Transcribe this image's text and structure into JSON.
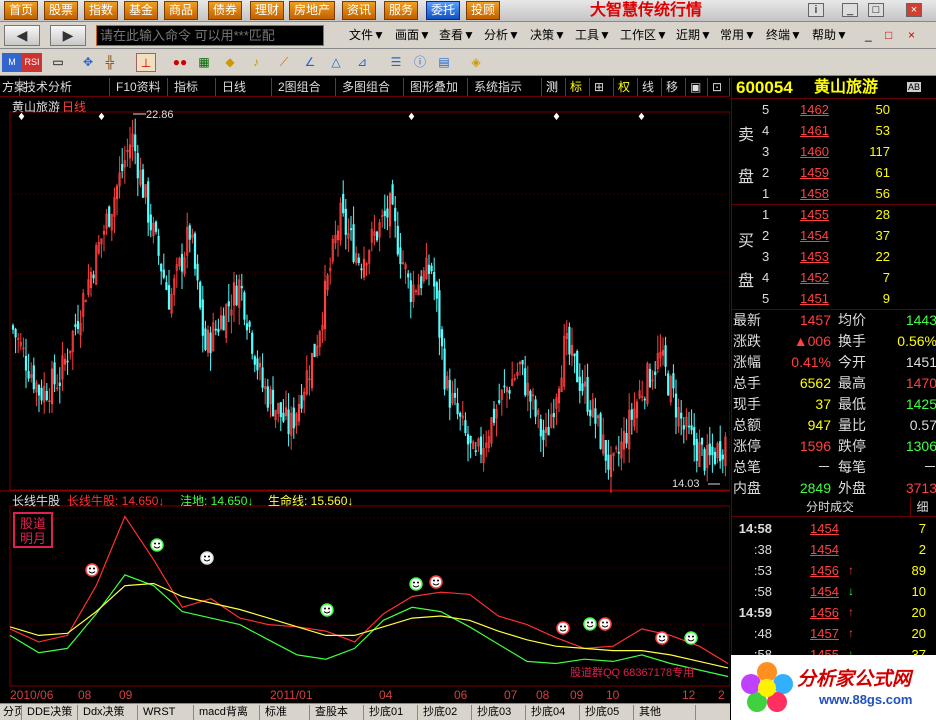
{
  "menu": {
    "buttons": [
      "首页",
      "股票",
      "指数",
      "基金",
      "商品",
      "债券",
      "理财",
      "房地产",
      "资讯",
      "服务",
      "委托",
      "投顾"
    ],
    "app_title": "大智慧传统行情",
    "win_controls": [
      "i",
      "_",
      "□",
      "×"
    ]
  },
  "toolbar": {
    "back": "◀",
    "forward": "▶",
    "command_placeholder": "请在此输入命令   可以用***匹配",
    "items": [
      "文件▼",
      "画面▼",
      "查看▼",
      "分析▼",
      "决策▼",
      "工具▼",
      "工作区▼",
      "近期▼",
      "常用▼",
      "终端▼",
      "帮助▼"
    ],
    "win_controls": [
      "_",
      "□",
      "×"
    ]
  },
  "tabs": [
    "方案",
    "技术分析",
    "F10资料",
    "指标",
    "日线",
    "2图组合",
    "多图组合",
    "图形叠加",
    "系统指示",
    "测",
    "标",
    "⊞",
    "权",
    "线",
    "移",
    "▣",
    "⊡"
  ],
  "chart": {
    "main_label_name": "黄山旅游",
    "main_label_period": "日线",
    "high_marker": "22.86",
    "low_marker": "14.03",
    "indicator_name": "长线牛股",
    "indicator_values": [
      {
        "label": "长线牛股: 14.650↓",
        "color": "#ff3030"
      },
      {
        "label": "洼地: 14.650↓",
        "color": "#40ff40"
      },
      {
        "label": "生命线: 15.560↓",
        "color": "#ffff40"
      }
    ],
    "stamp_line1": "股道",
    "stamp_line2": "明月",
    "watermark": "股道群QQ 68367178专用"
  },
  "chart_data": {
    "type": "line",
    "title": "黄山旅游 日线",
    "series": [
      {
        "name": "长线牛股",
        "color": "#ff3030",
        "values": [
          15.8,
          15.2,
          15.5,
          17.8,
          21.0,
          19.0,
          16.8,
          17.2,
          16.3,
          16.0,
          15.9,
          15.7,
          15.2,
          16.5,
          17.3,
          17.5,
          17.4,
          16.4,
          16.0,
          15.4,
          14.9,
          15.0,
          15.8,
          15.5,
          15.0,
          14.2
        ]
      },
      {
        "name": "洼地",
        "color": "#40ff40",
        "values": [
          15.5,
          14.7,
          14.9,
          16.5,
          18.3,
          17.8,
          16.6,
          16.3,
          16.0,
          15.3,
          14.6,
          14.4,
          14.9,
          16.2,
          16.8,
          16.6,
          15.9,
          15.1,
          14.3,
          14.2,
          14.4,
          14.3,
          14.6,
          14.2,
          13.9,
          13.6
        ]
      },
      {
        "name": "生命线",
        "color": "#ffff40",
        "values": [
          15.9,
          15.5,
          15.6,
          16.6,
          17.8,
          17.9,
          17.3,
          17.0,
          16.7,
          16.3,
          15.9,
          15.5,
          15.5,
          15.9,
          16.3,
          16.4,
          16.2,
          15.7,
          15.3,
          15.0,
          14.9,
          14.8,
          14.8,
          14.6,
          14.3,
          14.0
        ]
      }
    ],
    "x_labels": [
      "2010/06",
      "08",
      "09",
      "2011/01",
      "04",
      "06",
      "07",
      "08",
      "09",
      "10",
      "12",
      "2"
    ]
  },
  "quote": {
    "code": "600054",
    "name": "黄山旅游",
    "badge": "AB",
    "sell_label": [
      "卖",
      "盘"
    ],
    "buy_label": [
      "买",
      "盘"
    ],
    "sell": [
      {
        "level": "5",
        "price": "1462",
        "vol": "50"
      },
      {
        "level": "4",
        "price": "1461",
        "vol": "53"
      },
      {
        "level": "3",
        "price": "1460",
        "vol": "117"
      },
      {
        "level": "2",
        "price": "1459",
        "vol": "61"
      },
      {
        "level": "1",
        "price": "1458",
        "vol": "56"
      }
    ],
    "buy": [
      {
        "level": "1",
        "price": "1455",
        "vol": "28"
      },
      {
        "level": "2",
        "price": "1454",
        "vol": "37"
      },
      {
        "level": "3",
        "price": "1453",
        "vol": "22"
      },
      {
        "level": "4",
        "price": "1452",
        "vol": "7"
      },
      {
        "level": "5",
        "price": "1451",
        "vol": "9"
      }
    ],
    "stats": [
      {
        "l1": "最新",
        "v1": "1457",
        "c1": "red",
        "l2": "均价",
        "v2": "1443",
        "c2": "grn"
      },
      {
        "l1": "涨跌",
        "v1": "▲006",
        "c1": "red",
        "l2": "换手",
        "v2": "0.56%",
        "c2": "yel"
      },
      {
        "l1": "涨幅",
        "v1": "0.41%",
        "c1": "red",
        "l2": "今开",
        "v2": "1451",
        "c2": "wht"
      },
      {
        "l1": "总手",
        "v1": "6562",
        "c1": "yel",
        "l2": "最高",
        "v2": "1470",
        "c2": "red"
      },
      {
        "l1": "现手",
        "v1": "37",
        "c1": "yel",
        "l2": "最低",
        "v2": "1425",
        "c2": "grn"
      },
      {
        "l1": "总额",
        "v1": "947",
        "c1": "yel",
        "l2": "量比",
        "v2": "0.57",
        "c2": "wht"
      },
      {
        "l1": "涨停",
        "v1": "1596",
        "c1": "red",
        "l2": "跌停",
        "v2": "1306",
        "c2": "grn"
      },
      {
        "l1": "总笔",
        "v1": "－",
        "c1": "wht",
        "l2": "每笔",
        "v2": "－",
        "c2": "wht"
      },
      {
        "l1": "内盘",
        "v1": "2849",
        "c1": "grn",
        "l2": "外盘",
        "v2": "3713",
        "c2": "red"
      }
    ],
    "trades_title": "分时成交",
    "trades_detail": "细",
    "trades": [
      {
        "time": "14:58",
        "price": "1454",
        "arrow": "",
        "vol": "7",
        "bold": true
      },
      {
        "time": ":38",
        "price": "1454",
        "arrow": "",
        "vol": "2",
        "bold": false
      },
      {
        "time": ":53",
        "price": "1456",
        "arrow": "↑",
        "vol": "89",
        "bold": false
      },
      {
        "time": ":58",
        "price": "1454",
        "arrow": "↓",
        "vol": "10",
        "bold": false
      },
      {
        "time": "14:59",
        "price": "1456",
        "arrow": "↑",
        "vol": "20",
        "bold": true
      },
      {
        "time": ":48",
        "price": "1457",
        "arrow": "↑",
        "vol": "20",
        "bold": false
      },
      {
        "time": ":58",
        "price": "1455",
        "arrow": "↓",
        "vol": "37",
        "bold": false
      }
    ]
  },
  "bottom_tabs": [
    "分页",
    "DDE决策",
    "Ddx决策",
    "WRST",
    "macd背离",
    "标准",
    "查股本",
    "抄底01",
    "抄底02",
    "抄底03",
    "抄底04",
    "抄底05",
    "其他"
  ],
  "logo": {
    "text": "分析家公式网",
    "url": "www.88gs.com"
  }
}
